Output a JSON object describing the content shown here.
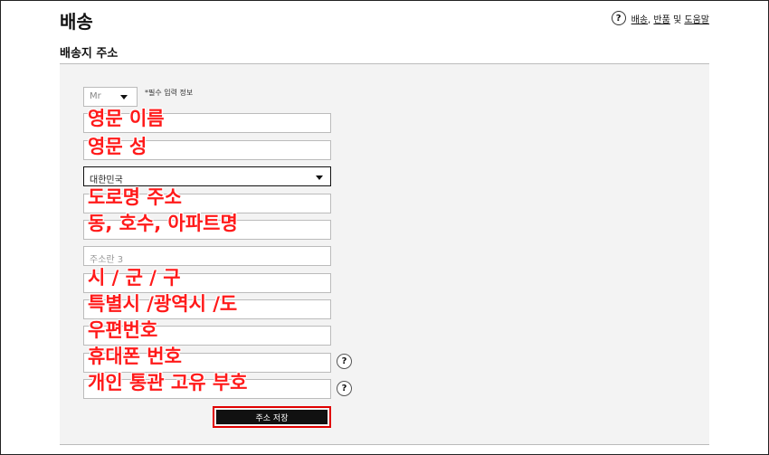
{
  "header": {
    "title": "배송",
    "help_icon": "?",
    "help_links": [
      "배송",
      "반품",
      "및",
      "도움말"
    ]
  },
  "section": {
    "title": "배송지 주소"
  },
  "form": {
    "salutation": "Mr",
    "required_note": "*필수 입력 정보",
    "country": "대한민국",
    "address3_placeholder": "주소란 3",
    "save_label": "주소 저장",
    "help_icon": "?"
  },
  "annotations": {
    "first_name": "영문 이름",
    "last_name": "영문 성",
    "road_address": "도로명 주소",
    "unit_apartment": "동, 호수, 아파트명",
    "city": "시 / 군 / 구",
    "province": "특별시 /광역시 /도",
    "postal_code": "우편번호",
    "mobile": "휴대폰 번호",
    "customs_id": "개인 통관 고유 부호"
  },
  "colors": {
    "annotation": "#ff1a1a",
    "button": "#111111",
    "highlight_border": "#e00000",
    "panel": "#f3f3f3"
  }
}
